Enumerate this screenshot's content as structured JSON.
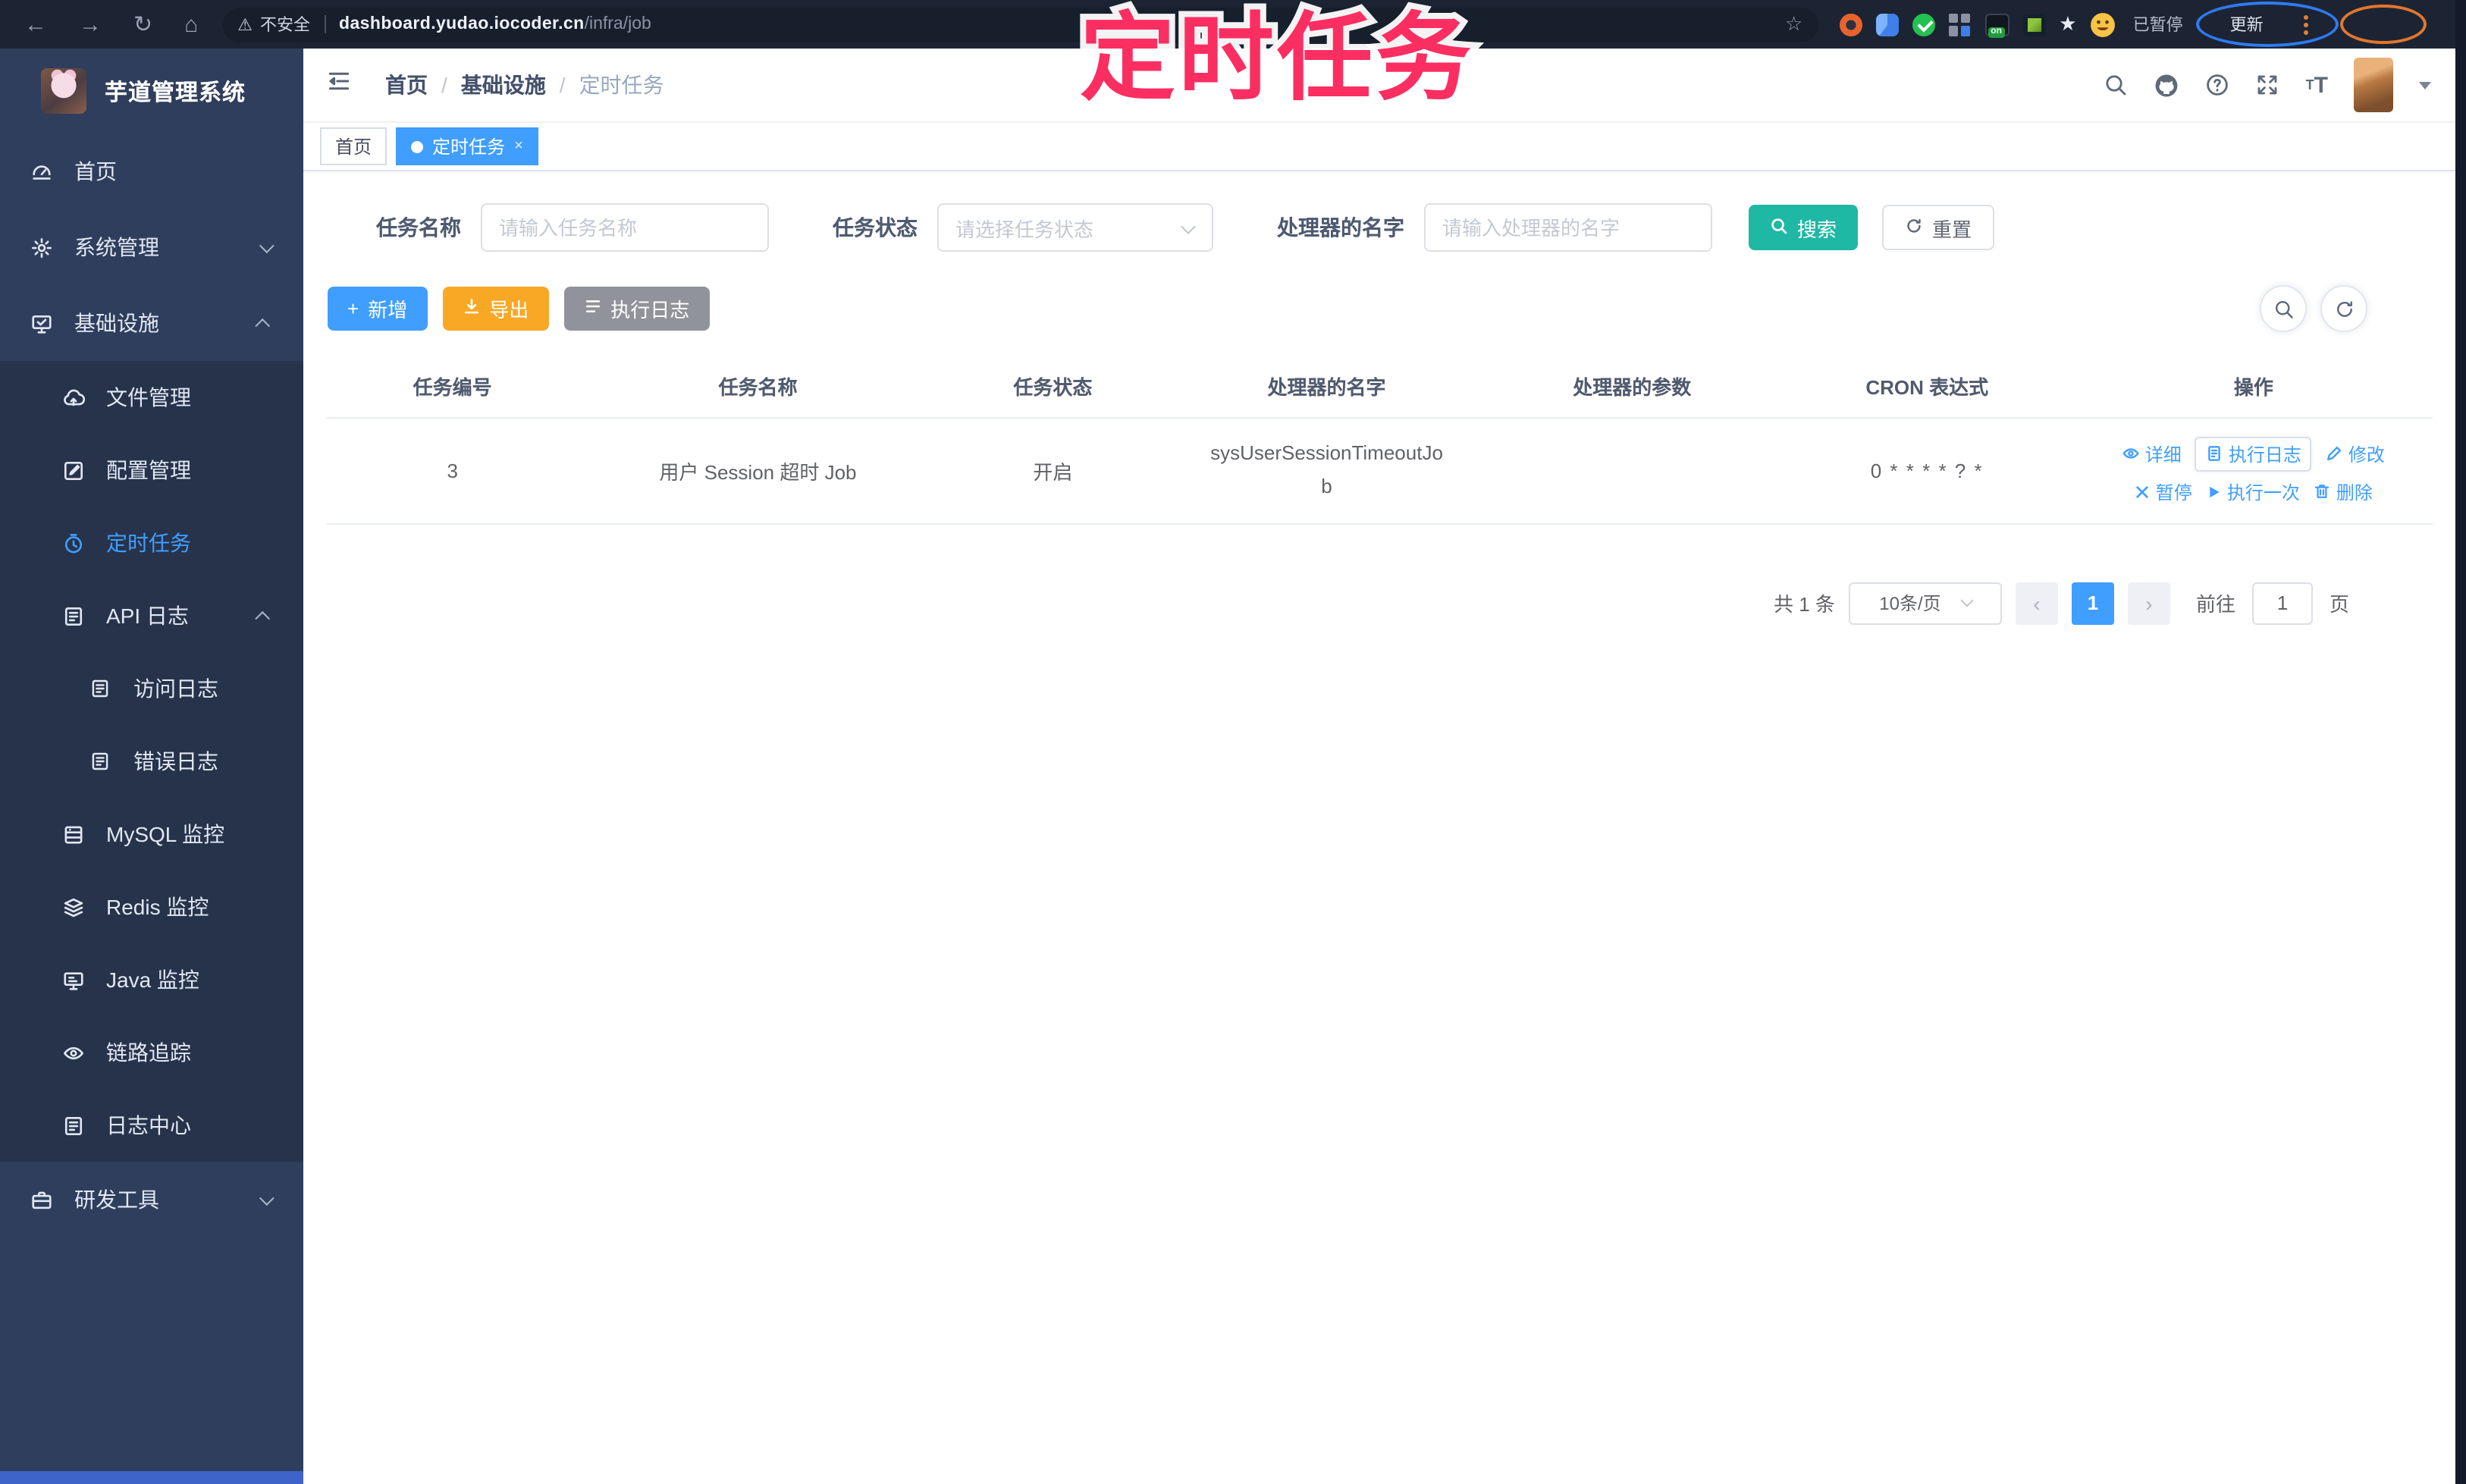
{
  "browser": {
    "insecure_label": "不安全",
    "url_domain": "dashboard.yudao.iocoder.cn",
    "url_path": "/infra/job",
    "extension_badge": "on",
    "paused_label": "已暂停",
    "update_label": "更新"
  },
  "annotation": {
    "text": "定时任务",
    "color": "#fb2e62"
  },
  "sidebar": {
    "title": "芋道管理系统",
    "items": [
      {
        "label": "首页",
        "icon": "dashboard"
      },
      {
        "label": "系统管理",
        "icon": "gear",
        "arrow": "down"
      },
      {
        "label": "基础设施",
        "icon": "infra",
        "arrow": "up"
      },
      {
        "label": "文件管理",
        "icon": "cloud"
      },
      {
        "label": "配置管理",
        "icon": "editsq"
      },
      {
        "label": "定时任务",
        "icon": "timer",
        "active": true
      },
      {
        "label": "API 日志",
        "icon": "logedit",
        "arrow": "up"
      },
      {
        "label": "访问日志",
        "icon": "docedit"
      },
      {
        "label": "错误日志",
        "icon": "docedit"
      },
      {
        "label": "MySQL 监控",
        "icon": "db"
      },
      {
        "label": "Redis 监控",
        "icon": "layers"
      },
      {
        "label": "Java 监控",
        "icon": "javamon"
      },
      {
        "label": "链路追踪",
        "icon": "eye"
      },
      {
        "label": "日志中心",
        "icon": "logedit"
      },
      {
        "label": "研发工具",
        "icon": "briefcase",
        "arrow": "down"
      }
    ]
  },
  "topbar": {
    "breadcrumb": [
      "首页",
      "基础设施",
      "定时任务"
    ],
    "separator": "/"
  },
  "tabs": [
    {
      "label": "首页"
    },
    {
      "label": "定时任务",
      "active": true,
      "close": "×"
    }
  ],
  "filters": {
    "name_label": "任务名称",
    "name_placeholder": "请输入任务名称",
    "status_label": "任务状态",
    "status_placeholder": "请选择任务状态",
    "handler_label": "处理器的名字",
    "handler_placeholder": "请输入处理器的名字",
    "search_label": "搜索",
    "reset_label": "重置"
  },
  "toolbar": {
    "add_label": "新增",
    "export_label": "导出",
    "exec_log_label": "执行日志"
  },
  "table": {
    "headers": [
      "任务编号",
      "任务名称",
      "任务状态",
      "处理器的名字",
      "处理器的参数",
      "CRON 表达式",
      "操作"
    ],
    "rows": [
      {
        "id": "3",
        "name": "用户 Session 超时 Job",
        "status": "开启",
        "handler": "sysUserSessionTimeoutJob",
        "param": "",
        "cron": "0 * * * * ? *"
      }
    ],
    "actions": {
      "detail": "详细",
      "exec_log": "执行日志",
      "edit": "修改",
      "pause": "暂停",
      "run_once": "执行一次",
      "delete": "删除"
    }
  },
  "pagination": {
    "total": "共 1 条",
    "page_size": "10条/页",
    "page": "1",
    "goto_label": "前往",
    "goto_value": "1",
    "unit_label": "页"
  },
  "colors": {
    "accent": "#409eff",
    "search_button": "#1fb8a5",
    "export_button": "#f9a825",
    "annotation_pink": "#fb2e62",
    "sidebar_bg": "#2f3e5c",
    "sidebar_submenu_bg": "#27334b",
    "browser_bar_bg": "#1c2433"
  }
}
